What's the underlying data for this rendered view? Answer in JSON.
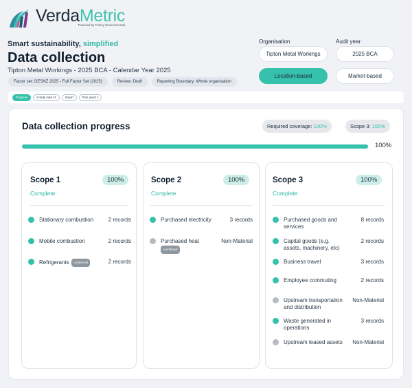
{
  "brand": {
    "name_part1": "Verda",
    "name_part2": "Metric",
    "tagline": "Powered by Turkey Environmental"
  },
  "header": {
    "tagline_main": "Smart sustainability,",
    "tagline_highlight": "simplified",
    "title": "Data collection",
    "subtitle": "Tipton Metal Workings - 2025 BCA - Calendar Year 2025",
    "chips": [
      "Factor set: DESNZ 2025 - Full Factor Set (2025)",
      "Review: Draft",
      "Reporting Boundary: Whole organisation"
    ]
  },
  "form": {
    "org_label": "Organisation",
    "org_value": "Tipton Metal Workings",
    "year_label": "Audit year",
    "year_value": "2025 BCA",
    "location_label": "Location-based",
    "market_label": "Market-based",
    "active_method": "location"
  },
  "tabs": [
    "Progress",
    "Activity rows 41",
    "Import",
    "Prior years 1"
  ],
  "progress": {
    "title": "Data collection progress",
    "coverage_label": "Required coverage:",
    "coverage_value": "100%",
    "scope3_label": "Scope 3:",
    "scope3_value": "100%",
    "overall_percent": 100,
    "overall_label": "100%"
  },
  "scopes": [
    {
      "title": "Scope 1",
      "percent": "100%",
      "status": "Complete",
      "items": [
        {
          "label": "Stationary combustion",
          "count": "2 records",
          "done": true
        },
        {
          "label": "Mobile combustion",
          "count": "2 records",
          "done": true
        },
        {
          "label": "Refrigerants",
          "count": "2 records",
          "done": true,
          "tag": "conditional"
        }
      ]
    },
    {
      "title": "Scope 2",
      "percent": "100%",
      "status": "Complete",
      "items": [
        {
          "label": "Purchased electricity",
          "count": "3 records",
          "done": true
        },
        {
          "label": "Purchased heat",
          "count": "Non-Material",
          "done": false,
          "tag": "conditional"
        }
      ]
    },
    {
      "title": "Scope 3",
      "percent": "100%",
      "status": "Complete",
      "items": [
        {
          "label": "Purchased goods and services",
          "count": "8 records",
          "done": true
        },
        {
          "label": "Capital goods (e.g. assets, machinery, etc)",
          "count": "2 records",
          "done": true
        },
        {
          "label": "Business travel",
          "count": "3 records",
          "done": true
        },
        {
          "label": "Employee commuting",
          "count": "2 records",
          "done": true
        },
        {
          "label": "Upstream transportation and distribution",
          "count": "Non-Material",
          "done": false
        },
        {
          "label": "Waste generated in operations",
          "count": "3 records",
          "done": true
        },
        {
          "label": "Upstream leased assets",
          "count": "Non-Material",
          "done": false
        }
      ]
    }
  ],
  "colors": {
    "accent": "#35c1ac",
    "ink": "#1c2b3a",
    "grey_dot": "#b8bcc2"
  }
}
